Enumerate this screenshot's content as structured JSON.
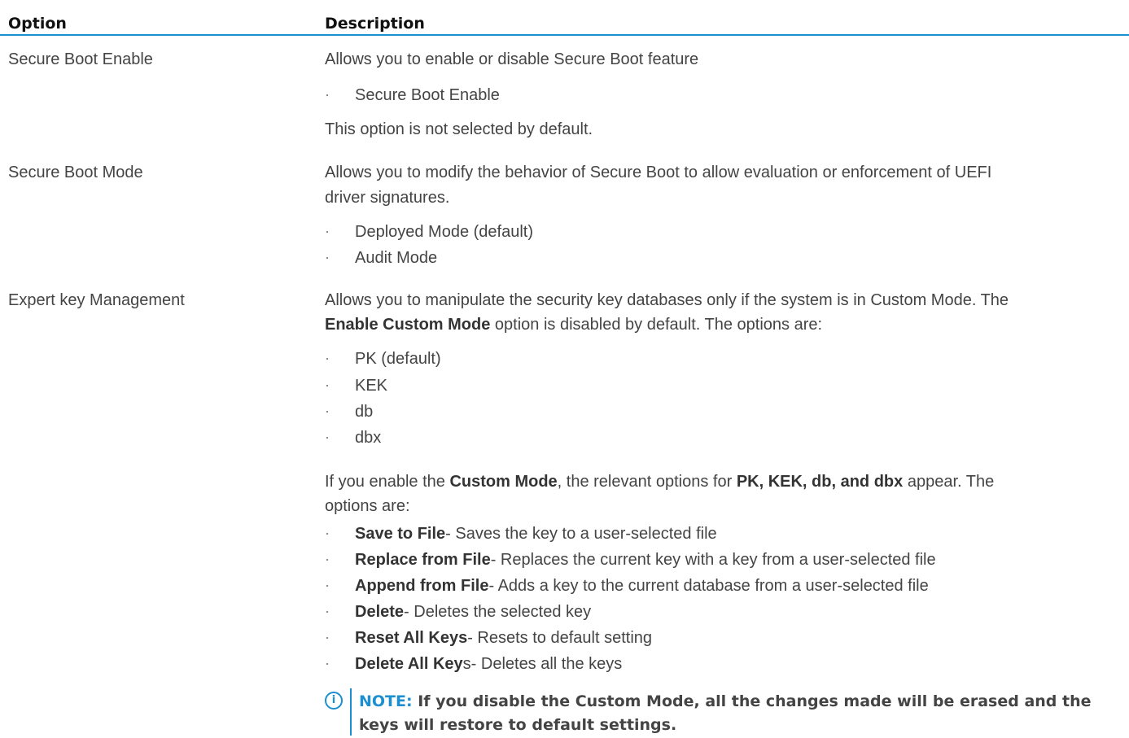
{
  "table": {
    "headers": {
      "option": "Option",
      "description": "Description"
    },
    "rows": [
      {
        "option": "Secure Boot Enable",
        "desc1": "Allows you to enable or disable Secure Boot feature",
        "list": [
          "Secure Boot Enable"
        ],
        "desc2": "This option is not selected by default."
      },
      {
        "option": "Secure Boot Mode",
        "desc1_line1": "Allows you to modify the behavior of Secure Boot to allow evaluation or enforcement of UEFI",
        "desc1_line2": "driver signatures.",
        "list": [
          "Deployed Mode (default)",
          "Audit Mode"
        ]
      },
      {
        "option": "Expert key Management",
        "desc1_line1": "Allows you to manipulate the security key databases only if the system is in Custom Mode. The",
        "desc1_line2_bold": "Enable Custom Mode",
        "desc1_line2_rest": " option is disabled by default. The options are:",
        "list": [
          "PK (default)",
          "KEK",
          "db",
          "dbx"
        ],
        "p2_a": "If you enable the ",
        "p2_b_bold": "Custom Mode",
        "p2_c": ", the relevant options for ",
        "p2_d_bold": "PK, KEK, db, and dbx",
        "p2_e": " appear. The",
        "p2_line2": "options are:",
        "actions": [
          {
            "bold": "Save to File",
            "rest": "- Saves the key to a user-selected file"
          },
          {
            "bold": "Replace from File",
            "rest": "- Replaces the current key with a key from a user-selected file"
          },
          {
            "bold": "Append from File",
            "rest": "- Adds a key to the current database from a user-selected file"
          },
          {
            "bold": "Delete",
            "rest": "- Deletes the selected key"
          },
          {
            "bold": "Reset All Keys",
            "rest": "- Resets to default setting"
          },
          {
            "bold": "Delete All Key",
            "rest": "s- Deletes all the keys"
          }
        ],
        "note_label": "NOTE:",
        "note_text": " If you disable the Custom Mode, all the changes made will be erased and the keys will restore to default settings."
      }
    ]
  },
  "colors": {
    "accent": "#1b8fd0",
    "text": "#444444"
  },
  "icons": {
    "bullet": "·",
    "note_icon": "info-icon"
  }
}
